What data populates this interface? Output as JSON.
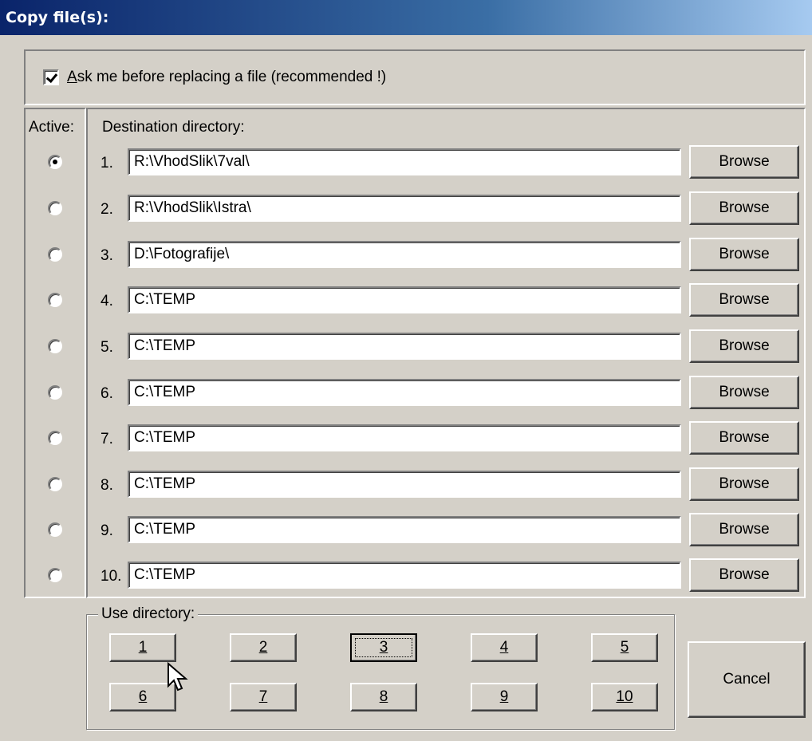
{
  "window": {
    "title": "Copy file(s):"
  },
  "options": {
    "ask_before_replace_label": "Ask me before replacing a file (recommended !)",
    "ask_before_replace_checked": true
  },
  "columns": {
    "active_header": "Active:",
    "destination_header": "Destination directory:"
  },
  "rows": [
    {
      "number": "1.",
      "path": "R:\\VhodSlik\\7val\\",
      "active": true,
      "browse_label": "Browse"
    },
    {
      "number": "2.",
      "path": "R:\\VhodSlik\\Istra\\",
      "active": false,
      "browse_label": "Browse"
    },
    {
      "number": "3.",
      "path": "D:\\Fotografije\\",
      "active": false,
      "browse_label": "Browse"
    },
    {
      "number": "4.",
      "path": "C:\\TEMP",
      "active": false,
      "browse_label": "Browse"
    },
    {
      "number": "5.",
      "path": "C:\\TEMP",
      "active": false,
      "browse_label": "Browse"
    },
    {
      "number": "6.",
      "path": "C:\\TEMP",
      "active": false,
      "browse_label": "Browse"
    },
    {
      "number": "7.",
      "path": "C:\\TEMP",
      "active": false,
      "browse_label": "Browse"
    },
    {
      "number": "8.",
      "path": "C:\\TEMP",
      "active": false,
      "browse_label": "Browse"
    },
    {
      "number": "9.",
      "path": "C:\\TEMP",
      "active": false,
      "browse_label": "Browse"
    },
    {
      "number": "10.",
      "path": "C:\\TEMP",
      "active": false,
      "browse_label": "Browse"
    }
  ],
  "use_directory": {
    "label": "Use directory:",
    "buttons": [
      "1",
      "2",
      "3",
      "4",
      "5",
      "6",
      "7",
      "8",
      "9",
      "10"
    ],
    "focused": "3"
  },
  "cancel_label": "Cancel"
}
